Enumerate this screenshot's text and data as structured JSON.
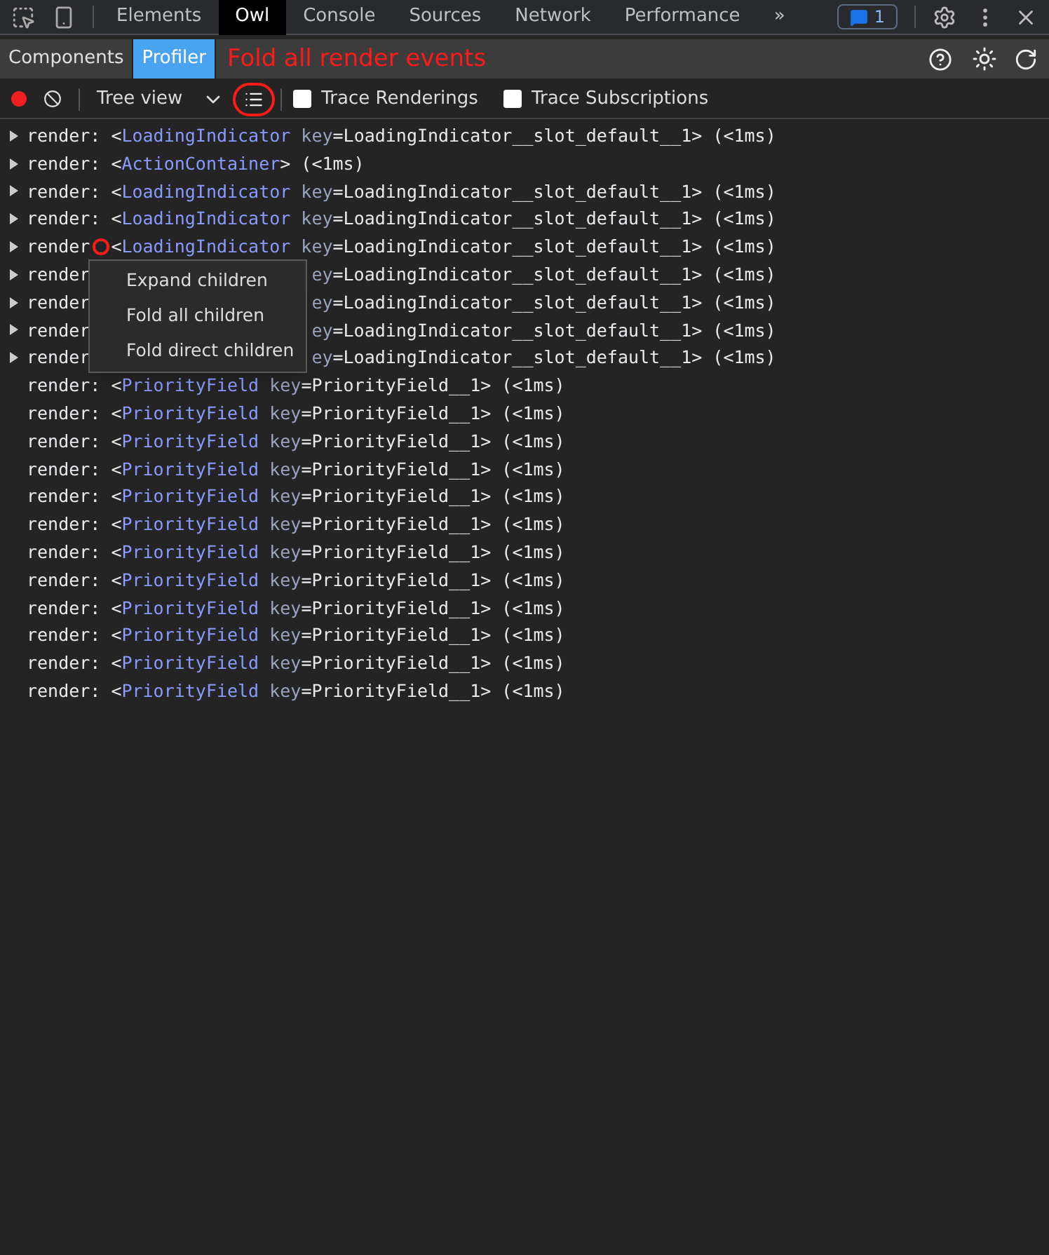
{
  "main_tabs": [
    {
      "label": "Elements",
      "selected": false
    },
    {
      "label": "Owl",
      "selected": true
    },
    {
      "label": "Console",
      "selected": false
    },
    {
      "label": "Sources",
      "selected": false
    },
    {
      "label": "Network",
      "selected": false
    },
    {
      "label": "Performance",
      "selected": false
    }
  ],
  "more_tabs": "»",
  "issues_badge": "1",
  "sub_tabs": [
    {
      "label": "Components",
      "selected": false
    },
    {
      "label": "Profiler",
      "selected": true
    }
  ],
  "toolbar": {
    "recording": true,
    "view_select": "Tree view",
    "checkboxes": [
      {
        "label": "Trace Renderings",
        "checked": false
      },
      {
        "label": "Trace Subscriptions",
        "checked": false
      }
    ]
  },
  "annotation": "Fold all render events",
  "rows": [
    {
      "kind": "full",
      "expandable": true,
      "lead": "render: <",
      "component": "LoadingIndicator",
      "key_label": " key",
      "rest": "=LoadingIndicator__slot_default__1> (<1ms)"
    },
    {
      "kind": "full",
      "expandable": true,
      "lead": "render: <",
      "component": "ActionContainer",
      "rest": "> (<1ms)"
    },
    {
      "kind": "full",
      "expandable": true,
      "lead": "render: <",
      "component": "LoadingIndicator",
      "key_label": " key",
      "rest": "=LoadingIndicator__slot_default__1> (<1ms)"
    },
    {
      "kind": "full",
      "expandable": true,
      "lead": "render: <",
      "component": "LoadingIndicator",
      "key_label": " key",
      "rest": "=LoadingIndicator__slot_default__1> (<1ms)"
    },
    {
      "kind": "marked",
      "expandable": true,
      "lead": "render",
      "tail_lead": "<",
      "component": "LoadingIndicator",
      "key_label": " key",
      "rest": "=LoadingIndicator__slot_default__1> (<1ms)"
    },
    {
      "kind": "covered",
      "expandable": true,
      "lead": "render",
      "key_label": "ey",
      "rest": "=LoadingIndicator__slot_default__1> (<1ms)"
    },
    {
      "kind": "covered",
      "expandable": true,
      "lead": "render",
      "key_label": "ey",
      "rest": "=LoadingIndicator__slot_default__1> (<1ms)"
    },
    {
      "kind": "covered",
      "expandable": true,
      "lead": "render",
      "key_label": "ey",
      "rest": "=LoadingIndicator__slot_default__1> (<1ms)"
    },
    {
      "kind": "covered",
      "expandable": true,
      "lead": "render",
      "key_label": "ey",
      "rest": "=LoadingIndicator__slot_default__1> (<1ms)"
    },
    {
      "kind": "full",
      "expandable": false,
      "lead": "render: <",
      "component": "PriorityField",
      "key_label": " key",
      "rest": "=PriorityField__1> (<1ms)"
    },
    {
      "kind": "full",
      "expandable": false,
      "lead": "render: <",
      "component": "PriorityField",
      "key_label": " key",
      "rest": "=PriorityField__1> (<1ms)"
    },
    {
      "kind": "full",
      "expandable": false,
      "lead": "render: <",
      "component": "PriorityField",
      "key_label": " key",
      "rest": "=PriorityField__1> (<1ms)"
    },
    {
      "kind": "full",
      "expandable": false,
      "lead": "render: <",
      "component": "PriorityField",
      "key_label": " key",
      "rest": "=PriorityField__1> (<1ms)"
    },
    {
      "kind": "full",
      "expandable": false,
      "lead": "render: <",
      "component": "PriorityField",
      "key_label": " key",
      "rest": "=PriorityField__1> (<1ms)"
    },
    {
      "kind": "full",
      "expandable": false,
      "lead": "render: <",
      "component": "PriorityField",
      "key_label": " key",
      "rest": "=PriorityField__1> (<1ms)"
    },
    {
      "kind": "full",
      "expandable": false,
      "lead": "render: <",
      "component": "PriorityField",
      "key_label": " key",
      "rest": "=PriorityField__1> (<1ms)"
    },
    {
      "kind": "full",
      "expandable": false,
      "lead": "render: <",
      "component": "PriorityField",
      "key_label": " key",
      "rest": "=PriorityField__1> (<1ms)"
    },
    {
      "kind": "full",
      "expandable": false,
      "lead": "render: <",
      "component": "PriorityField",
      "key_label": " key",
      "rest": "=PriorityField__1> (<1ms)"
    },
    {
      "kind": "full",
      "expandable": false,
      "lead": "render: <",
      "component": "PriorityField",
      "key_label": " key",
      "rest": "=PriorityField__1> (<1ms)"
    },
    {
      "kind": "full",
      "expandable": false,
      "lead": "render: <",
      "component": "PriorityField",
      "key_label": " key",
      "rest": "=PriorityField__1> (<1ms)"
    },
    {
      "kind": "full",
      "expandable": false,
      "lead": "render: <",
      "component": "PriorityField",
      "key_label": " key",
      "rest": "=PriorityField__1> (<1ms)"
    }
  ],
  "context_menu": [
    "Expand children",
    "Fold all children",
    "Fold direct children"
  ]
}
